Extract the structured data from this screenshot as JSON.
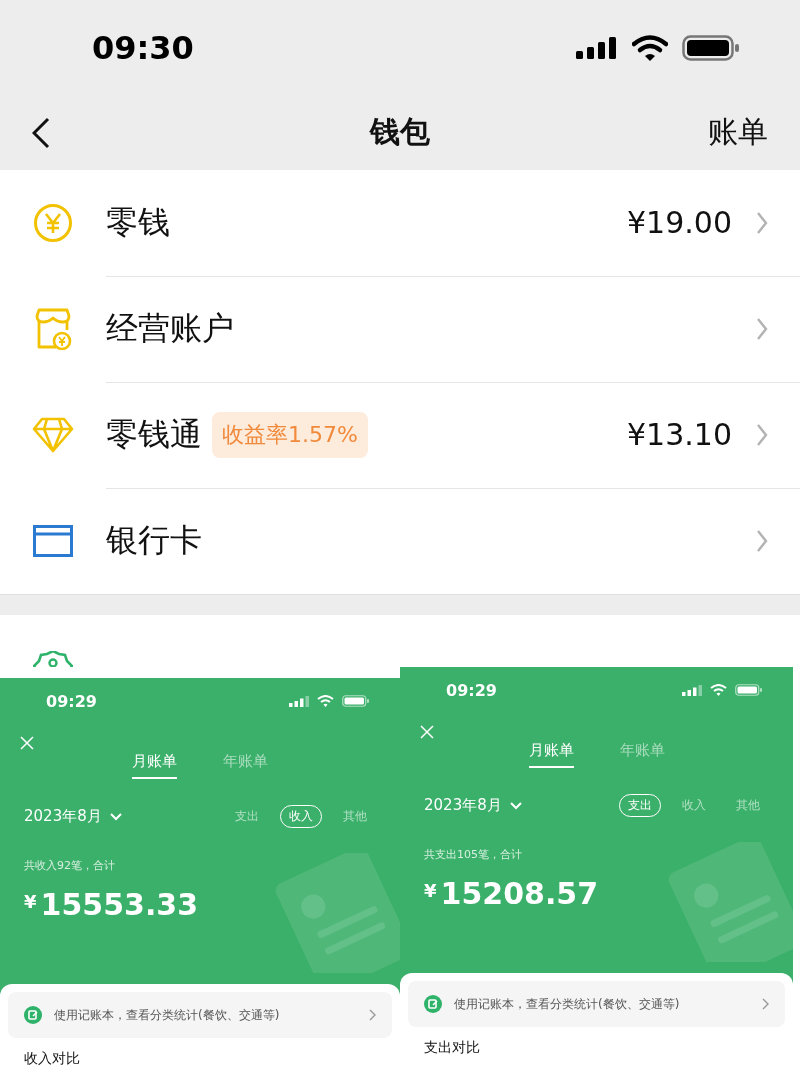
{
  "status_bar": {
    "time": "09:30"
  },
  "nav": {
    "title": "钱包",
    "action": "账单"
  },
  "wallet_items": [
    {
      "kind": "coin",
      "name": "零钱",
      "amount": "¥19.00"
    },
    {
      "kind": "shop",
      "name": "经营账户"
    },
    {
      "kind": "diamond",
      "name": "零钱通",
      "badge": "收益率1.57%",
      "amount": "¥13.10"
    },
    {
      "kind": "card",
      "name": "银行卡"
    }
  ],
  "bill_panels": [
    {
      "time": "09:29",
      "tabs": [
        {
          "label": "月账单",
          "selected": true
        },
        {
          "label": "年账单",
          "selected": false
        }
      ],
      "month": "2023年8月",
      "filters": [
        {
          "label": "支出",
          "selected": false
        },
        {
          "label": "收入",
          "selected": true
        },
        {
          "label": "其他",
          "selected": false
        }
      ],
      "summary": "共收入92笔，合计",
      "currency": "¥",
      "total": "15553.33",
      "tip": "使用记账本，查看分类统计(餐饮、交通等)",
      "section": "收入对比"
    },
    {
      "time": "09:29",
      "tabs": [
        {
          "label": "月账单",
          "selected": true
        },
        {
          "label": "年账单",
          "selected": false
        }
      ],
      "month": "2023年8月",
      "filters": [
        {
          "label": "支出",
          "selected": true
        },
        {
          "label": "收入",
          "selected": false
        },
        {
          "label": "其他",
          "selected": false
        }
      ],
      "summary": "共支出105笔，合计",
      "currency": "¥",
      "total": "15208.57",
      "tip": "使用记账本，查看分类统计(餐饮、交通等)",
      "section": "支出对比"
    }
  ]
}
